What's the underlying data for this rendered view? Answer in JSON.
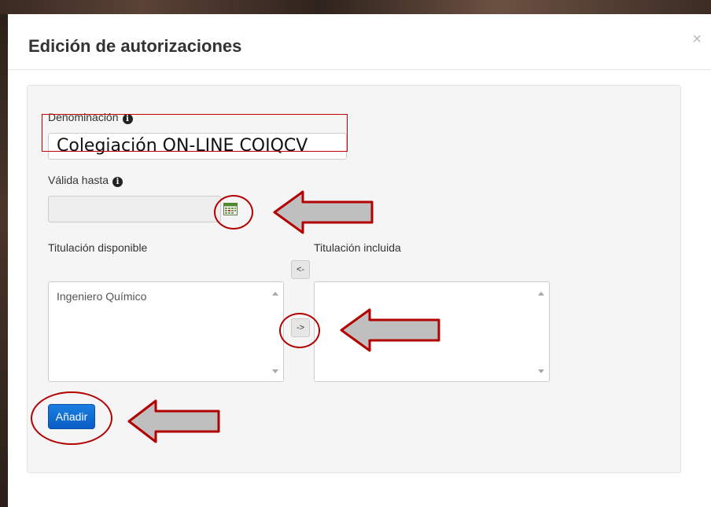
{
  "dialog": {
    "title": "Edición de autorizaciones",
    "close_label": "×"
  },
  "form": {
    "denomination_label": "Denominación",
    "denomination_value": "Colegiación ON-LINE COIQCV",
    "valid_until_label": "Válida hasta",
    "valid_until_value": "",
    "info_icon_glyph": "i",
    "calendar_icon": "calendar-icon"
  },
  "titulaciones": {
    "available_label": "Titulación disponible",
    "included_label": "Titulación incluida",
    "available_items": [
      "Ingeniero Químico"
    ],
    "included_items": [],
    "remove_button_label": "<-",
    "add_button_label": "->"
  },
  "actions": {
    "submit_label": "Añadir"
  },
  "annotations": {
    "highlight_color": "#c00000",
    "arrow_fill": "#bfbfbf",
    "arrow_stroke": "#b30000"
  }
}
